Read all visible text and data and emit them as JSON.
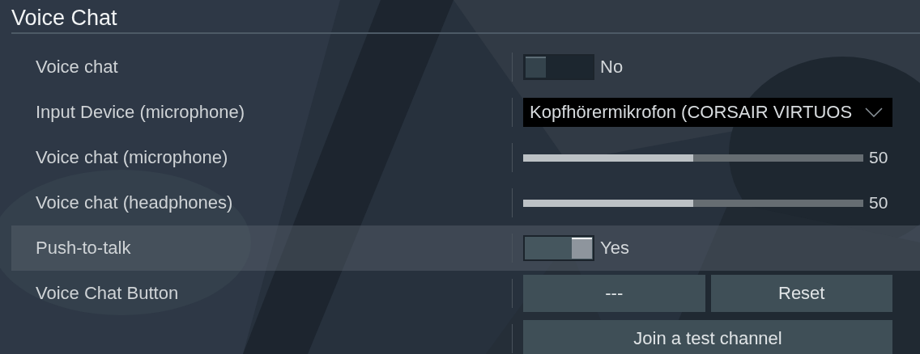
{
  "section": {
    "title": "Voice Chat"
  },
  "rows": [
    {
      "kind": "toggle",
      "label": "Voice chat",
      "selected": false,
      "on": false,
      "value": "No"
    },
    {
      "kind": "dropdown",
      "label": "Input Device (microphone)",
      "selected": false,
      "value": "Kopfhörermikrofon (CORSAIR VIRTUOS"
    },
    {
      "kind": "slider",
      "label": "Voice chat (microphone)",
      "selected": false,
      "level": 0.5,
      "value": "50"
    },
    {
      "kind": "slider",
      "label": "Voice chat (headphones)",
      "selected": false,
      "level": 0.5,
      "value": "50"
    },
    {
      "kind": "toggle",
      "label": "Push-to-talk",
      "selected": true,
      "on": true,
      "value": "Yes"
    },
    {
      "kind": "buttons",
      "label": "Voice Chat Button",
      "selected": false,
      "buttons": [
        "---",
        "Reset"
      ]
    },
    {
      "kind": "buttons",
      "selected": false,
      "buttons": [
        "Join a test channel"
      ]
    }
  ]
}
